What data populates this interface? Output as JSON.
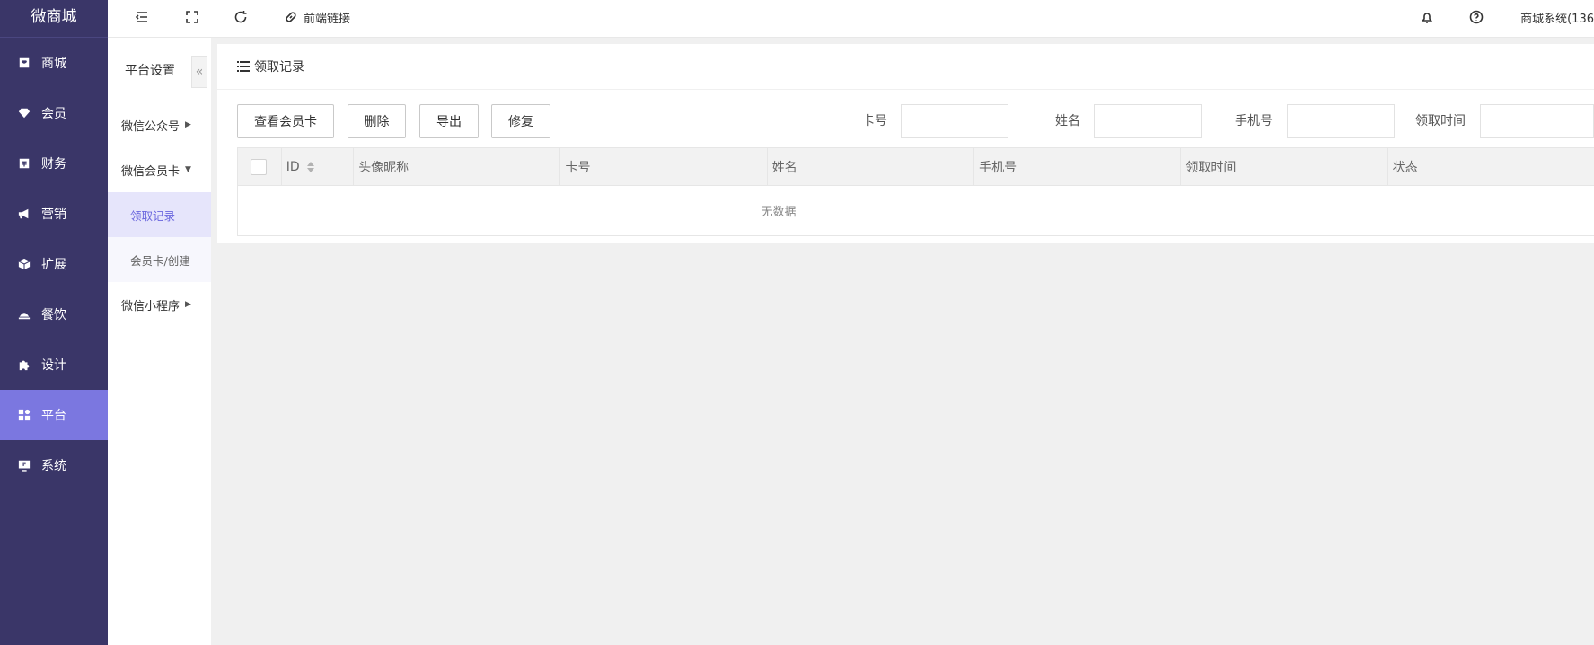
{
  "brand": "微商城",
  "nav": {
    "items": [
      {
        "label": "商城",
        "icon": "shop-bag-icon"
      },
      {
        "label": "会员",
        "icon": "gem-icon"
      },
      {
        "label": "财务",
        "icon": "wallet-icon"
      },
      {
        "label": "营销",
        "icon": "megaphone-icon"
      },
      {
        "label": "扩展",
        "icon": "cube-icon"
      },
      {
        "label": "餐饮",
        "icon": "dish-cover-icon"
      },
      {
        "label": "设计",
        "icon": "puzzle-icon"
      },
      {
        "label": "平台",
        "icon": "grid-apps-icon"
      },
      {
        "label": "系统",
        "icon": "monitor-icon"
      }
    ],
    "active": "平台"
  },
  "subnav": {
    "title": "平台设置",
    "collapse_icon": "«",
    "groups": [
      {
        "label": "微信公众号"
      },
      {
        "label": "微信会员卡",
        "children": [
          {
            "label": "领取记录"
          },
          {
            "label": "会员卡/创建"
          }
        ]
      },
      {
        "label": "微信小程序"
      }
    ],
    "active": "领取记录"
  },
  "topbar": {
    "frontend_link": "前端链接",
    "user": "商城系统(136"
  },
  "panel": {
    "title": "领取记录",
    "buttons": {
      "view_card": "查看会员卡",
      "delete": "删除",
      "export": "导出",
      "repair": "修复"
    },
    "filters": {
      "card_no": "卡号",
      "name": "姓名",
      "phone": "手机号",
      "receive_time": "领取时间"
    },
    "table": {
      "columns": [
        "ID",
        "头像昵称",
        "卡号",
        "姓名",
        "手机号",
        "领取时间",
        "状态"
      ],
      "empty_text": "无数据"
    }
  },
  "colors": {
    "sidebar_bg": "#3a3668",
    "sidebar_active": "#7b77e0",
    "sub_active_bg": "#e6e5fb",
    "sub_active_text": "#6a66de"
  }
}
